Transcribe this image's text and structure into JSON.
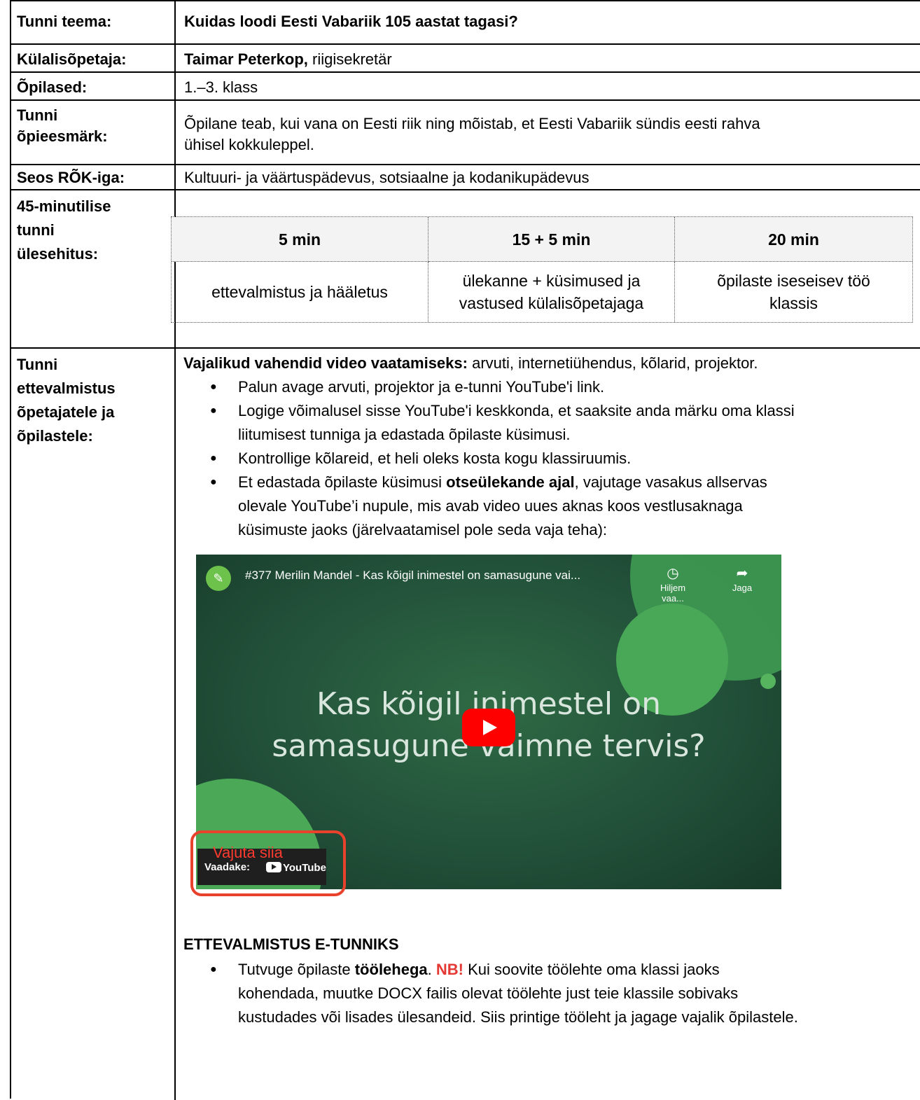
{
  "lesson": {
    "topic_label": "Tunni teema:",
    "topic_value": "Kuidas loodi Eesti Vabariik 105 aastat tagasi?",
    "guest_label": "Külalisõpetaja:",
    "guest_name": "Taimar Peterkop,",
    "guest_role": "riigisekretär",
    "students_label": "Õpilased:",
    "students_value": "1.–3. klass",
    "goal_label_1": "Tunni",
    "goal_label_2": "õpieesmärk:",
    "goal_value_1": "Õpilane teab, kui vana on Eesti riik ning mõistab, et Eesti Vabariik sündis eesti rahva",
    "goal_value_2": "ühisel kokkuleppel.",
    "curriculum_label": "Seos RÕK-iga:",
    "curriculum_value": "Kultuuri- ja väärtuspädevus, sotsiaalne ja kodanikupädevus",
    "structure_label_1": "45-minutilise",
    "structure_label_2": "tunni",
    "structure_label_3": "ülesehitus:"
  },
  "schedule": {
    "headers": [
      "5 min",
      "15 + 5 min",
      "20 min"
    ],
    "cells": [
      [
        "ettevalmistus ja hääletus"
      ],
      [
        "ülekanne + küsimused ja",
        "vastused külalisõpetajaga"
      ],
      [
        "õpilaste iseseisev töö",
        "klassis"
      ]
    ]
  },
  "prep": {
    "label_1": "Tunni",
    "label_2": "ettevalmistus",
    "label_3": "õpetajatele ja",
    "label_4": "õpilastele:",
    "intro_bold": "Vajalikud vahendid video vaatamiseks:",
    "intro_rest": " arvuti, internetiühendus, kõlarid, projektor.",
    "bullet_1": "Palun avage arvuti, projektor ja e-tunni YouTube'i link.",
    "bullet_2a": "Logige võimalusel sisse YouTube'i keskkonda, et saaksite anda märku oma klassi",
    "bullet_2b": "liitumisest tunniga ja edastada õpilaste küsimusi.",
    "bullet_3": "Kontrollige kõlareid, et heli oleks kosta kogu klassiruumis.",
    "bullet_4a_pre": "Et edastada õpilaste küsimusi ",
    "bullet_4a_bold": "otseülekande ajal",
    "bullet_4a_post": ", vajutage vasakus allservas",
    "bullet_4b": "olevale YouTube’i nupule, mis avab video uues aknas koos vestlusaknaga",
    "bullet_4c": "küsimuste jaoks (järelvaatamisel pole seda vaja teha):",
    "section_title": "ETTEVALMISTUS E-TUNNIKS",
    "b5_1_pre": "Tutvuge õpilaste ",
    "b5_1_bold": "töölehega",
    "b5_1_mid": ". ",
    "b5_1_nb": "NB!",
    "b5_1_post": " Kui soovite töölehte oma klassi jaoks",
    "b5_2": "kohendada, muutke DOCX failis olevat töölehte just teie klassile sobivaks",
    "b5_3": "kustudades või lisades ülesandeid. Siis printige tööleht ja jagage vajalik õpilastele."
  },
  "video": {
    "title": "#377 Merilin Mandel - Kas kõigil inimestel on samasugune vai...",
    "watch_later": "Hiljem vaa...",
    "share": "Jaga",
    "headline_1": "Kas kõigil inimestel on",
    "headline_2": "samasugune vaimne tervis?",
    "click_here": "Vajuta siia",
    "watch_on": "Vaadake:",
    "youtube": "YouTube",
    "icons": {
      "clock": "clock-icon",
      "share": "share-arrow-icon",
      "play": "play-icon"
    }
  },
  "colors": {
    "nb_red": "#e53935",
    "annotation_red": "#e8412c",
    "schedule_header_bg": "#f3f3f3"
  }
}
